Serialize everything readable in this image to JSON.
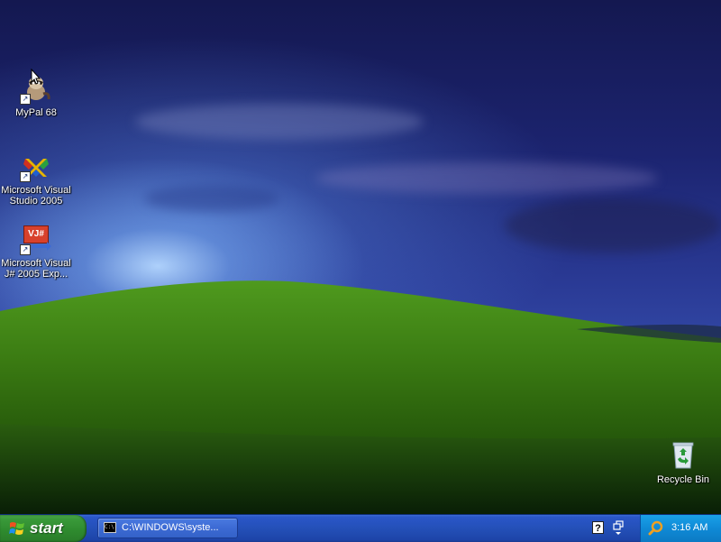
{
  "desktop": {
    "icons": [
      {
        "label": "MyPal 68",
        "icon": "mypal-raccoon-icon"
      },
      {
        "label": "Microsoft Visual Studio 2005",
        "icon": "visual-studio-icon"
      },
      {
        "label": "Microsoft Visual J# 2005 Exp...",
        "icon": "visual-jsharp-icon"
      },
      {
        "label": "Recycle Bin",
        "icon": "recycle-bin-icon"
      }
    ],
    "jsharp_badge": "VJ#"
  },
  "taskbar": {
    "start_label": "start",
    "task_items": [
      {
        "label": "C:\\WINDOWS\\syste...",
        "icon": "command-prompt-icon",
        "icon_text": "C:\\"
      }
    ],
    "help_glyph": "?",
    "clock": "3:16 AM"
  },
  "colors": {
    "taskbar_blue": "#2450b8",
    "start_green": "#2e8a2e",
    "tray_blue": "#0f8ad6"
  }
}
